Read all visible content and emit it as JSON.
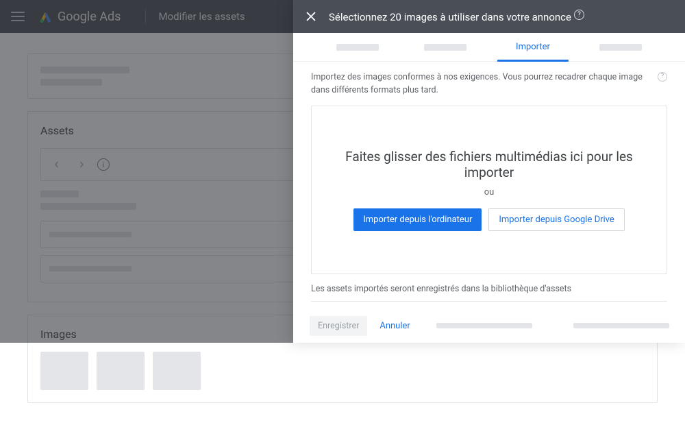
{
  "header": {
    "product": "Google Ads",
    "section": "Modifier les assets"
  },
  "page": {
    "assets_title": "Assets",
    "images_title": "Images"
  },
  "modal": {
    "title": "Sélectionnez 20 images à utiliser dans votre annonce",
    "tabs": {
      "active_label": "Importer"
    },
    "intro": "Importez des images conformes à nos exigences. Vous pourrez recadrer chaque image dans différents formats plus tard.",
    "dropzone": {
      "title": "Faites glisser des fichiers multimédias ici pour les importer",
      "or": "ou",
      "import_computer": "Importer depuis l'ordinateur",
      "import_drive": "Importer depuis Google Drive"
    },
    "note": "Les assets importés seront enregistrés dans la bibliothèque d'assets",
    "footer": {
      "save": "Enregistrer",
      "cancel": "Annuler"
    }
  }
}
